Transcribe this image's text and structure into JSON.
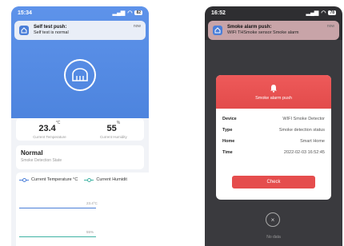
{
  "left": {
    "status": {
      "time": "15:34",
      "battery": "82"
    },
    "notification": {
      "title": "Self test push:",
      "body": "Self test is normal",
      "time": "now"
    },
    "readings": {
      "temperature": {
        "value": "23.4",
        "unit": "°C",
        "label": "Current Temperature"
      },
      "humidity": {
        "value": "55",
        "unit": "%",
        "label": "Current Humidity"
      }
    },
    "state": {
      "title": "Normal",
      "label": "Smoke Detection State"
    },
    "chart": {
      "legend": [
        "Current Temperature °C",
        "Current Humidit"
      ],
      "line_labels": [
        "23.4°C",
        "55%"
      ]
    }
  },
  "right": {
    "status": {
      "time": "16:52",
      "battery": "78"
    },
    "notification": {
      "title": "Smoke alarm push:",
      "body": "WIFI THSmoke sensor Smoke alarm",
      "time": "now"
    },
    "modal": {
      "title": "Smoke alarm push",
      "rows": [
        {
          "key": "Device",
          "value": "WIFI Smoke Detector"
        },
        {
          "key": "Type",
          "value": "Smoke detection status"
        },
        {
          "key": "Home",
          "value": "Smart Home"
        },
        {
          "key": "Time",
          "value": "2022-02-03 16:52:45"
        }
      ],
      "button": "Check",
      "close": "×"
    },
    "bottom": "No data"
  }
}
